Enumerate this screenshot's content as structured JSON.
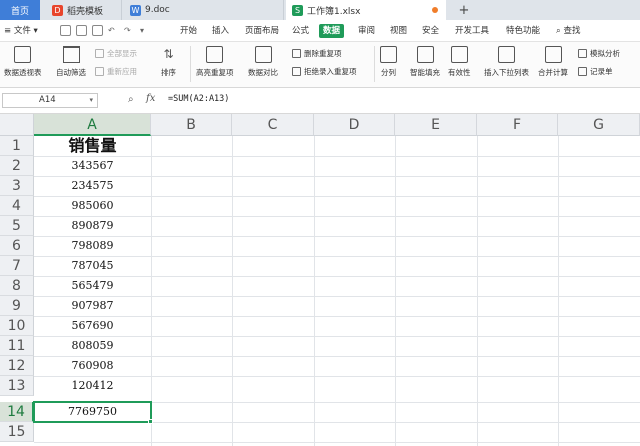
{
  "tabs": {
    "home": "首页",
    "doc1": "稻壳模板",
    "doc2": "9.doc",
    "active": "工作簿1.xlsx",
    "add": "+"
  },
  "menu": {
    "file": "文件",
    "items": [
      "开始",
      "插入",
      "页面布局",
      "公式",
      "数据",
      "审阅",
      "视图",
      "安全",
      "开发工具",
      "特色功能"
    ],
    "search": "查找"
  },
  "ribbon": {
    "pivot": "数据透视表",
    "autofilter": "自动筛选",
    "show_all": "全部显示",
    "reapply": "重新应用",
    "sort": "排序",
    "highlight_dup": "高亮重复项",
    "compare": "数据对比",
    "remove_dup": "删除重复项",
    "reject_dup": "拒绝录入重复项",
    "split": "分列",
    "smart_fill": "智能填充",
    "validity": "有效性",
    "dropdown": "插入下拉列表",
    "merge_calc": "合并计算",
    "simulate": "模拟分析",
    "record": "记录单"
  },
  "formula_bar": {
    "cell_ref": "A14",
    "fx": "fx",
    "formula": "=SUM(A2:A13)"
  },
  "grid": {
    "columns": [
      "A",
      "B",
      "C",
      "D",
      "E",
      "F",
      "G"
    ],
    "rows": [
      "1",
      "2",
      "3",
      "4",
      "5",
      "6",
      "7",
      "8",
      "9",
      "10",
      "11",
      "12",
      "13",
      "14",
      "15"
    ],
    "col_a": [
      "销售量",
      "343567",
      "234575",
      "985060",
      "890879",
      "798089",
      "787045",
      "565479",
      "907987",
      "567690",
      "808059",
      "760908",
      "120412",
      "7769750",
      ""
    ]
  },
  "colors": {
    "accent": "#1f9b59",
    "home_tab": "#3f7ed8"
  }
}
